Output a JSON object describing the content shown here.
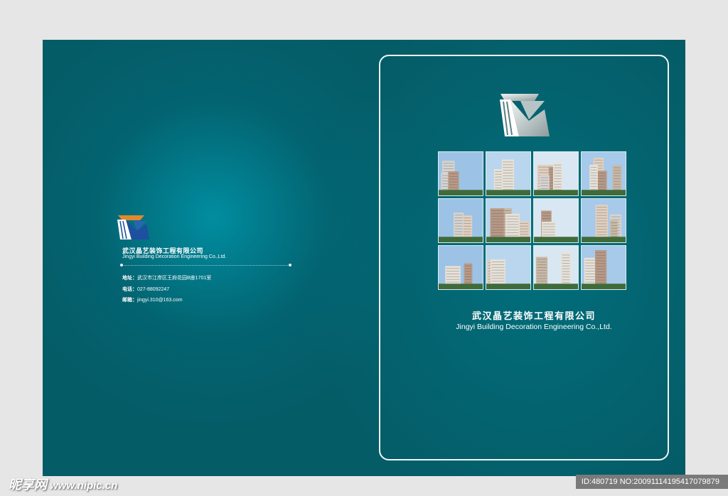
{
  "back_cover": {
    "company_cn": "武汉晶艺装饰工程有限公司",
    "company_en": "Jingyi Building Decoration Engineering Co.,Ltd.",
    "address_label": "地址：",
    "address": "武汉市江岸区王府花园B座1701室",
    "phone_label": "电话：",
    "phone": "027-88092247",
    "email_label": "邮箱：",
    "email": "jingyi.310@163.com"
  },
  "front_cover": {
    "company_cn": "武汉晶艺装饰工程有限公司",
    "company_en": "Jingyi Building Decoration Engineering Co.,Ltd.",
    "photo_grid": {
      "rows": 3,
      "columns": 4,
      "subject": "building-photo"
    }
  },
  "watermark": {
    "site_name": "昵享网",
    "site_url": "www.nipic.cn",
    "image_id": "ID:480719 NO:20091114195417079879"
  },
  "colors": {
    "page_background": "#e6e6e6",
    "cover_teal": "#045c67",
    "logo_orange": "#e08a2a",
    "logo_blue": "#1e4fa0",
    "logo_silver": "#c8d2d4"
  }
}
